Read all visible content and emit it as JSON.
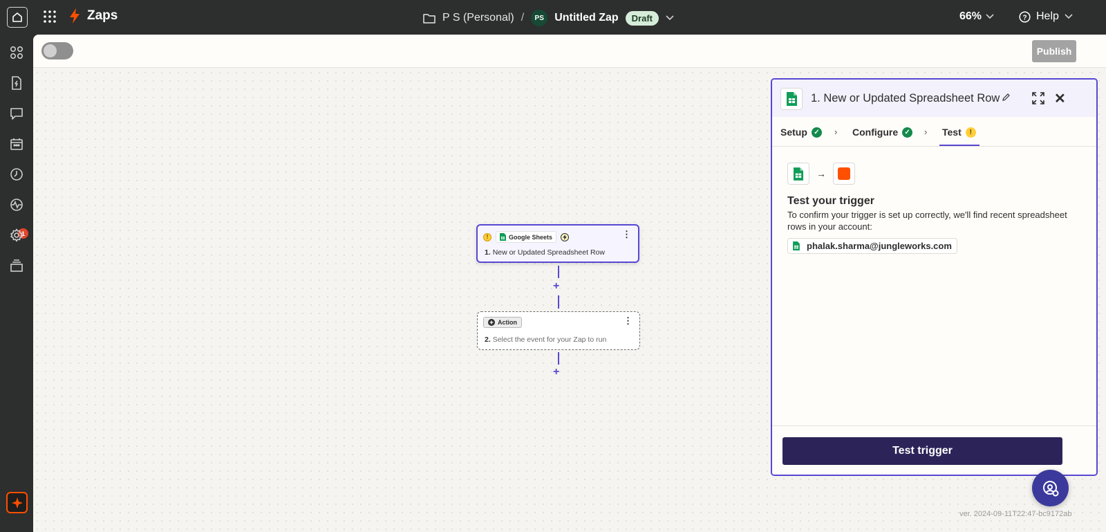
{
  "app": {
    "name": "Zaps",
    "accent": "#ff4f00",
    "brand_purple": "#5747d3"
  },
  "header": {
    "folder": "P S (Personal)",
    "separator": "/",
    "owner_initials": "PS",
    "zap_title": "Untitled Zap",
    "status_badge": "Draft",
    "zoom": "66%",
    "help_label": "Help"
  },
  "sidebar": {
    "items": [
      {
        "icon": "apps-icon"
      },
      {
        "icon": "zap-file-icon"
      },
      {
        "icon": "chat-icon"
      },
      {
        "icon": "calendar-icon"
      },
      {
        "icon": "history-icon"
      },
      {
        "icon": "activity-icon",
        "badge": "1"
      },
      {
        "icon": "settings-icon"
      },
      {
        "icon": "stack-icon"
      }
    ]
  },
  "toolbar": {
    "publish_label": "Publish",
    "enabled": false
  },
  "canvas": {
    "trigger_node": {
      "app": "Google Sheets",
      "step": "1.",
      "title": "New or Updated Spreadsheet Row"
    },
    "action_node": {
      "chip": "Action",
      "step": "2.",
      "title": "Select the event for your Zap to run"
    },
    "add_symbol": "+"
  },
  "panel": {
    "title": "1. New or Updated Spreadsheet Row",
    "tabs": [
      {
        "label": "Setup",
        "status": "complete"
      },
      {
        "label": "Configure",
        "status": "complete"
      },
      {
        "label": "Test",
        "status": "warning"
      }
    ],
    "heading": "Test your trigger",
    "description": "To confirm your trigger is set up correctly, we'll find recent spreadsheet rows in your account:",
    "account": "phalak.sharma@jungleworks.com",
    "button": "Test trigger"
  },
  "footer": {
    "version": "ver. 2024-09-11T22:47-bc9172ab"
  }
}
